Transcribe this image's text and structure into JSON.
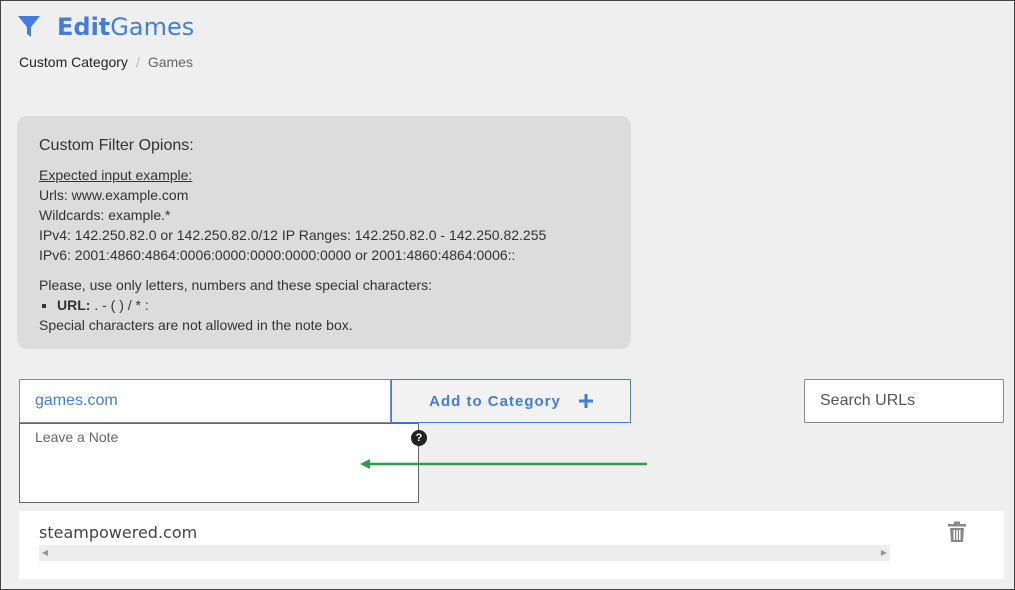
{
  "header": {
    "title_bold": "Edit",
    "title_rest": "Games",
    "icon": "filter-icon"
  },
  "breadcrumb": {
    "items": [
      "Custom Category",
      "Games"
    ],
    "separator": "/"
  },
  "info": {
    "heading": "Custom Filter Opions:",
    "example_label": "Expected input example:",
    "lines": [
      "Urls: www.example.com",
      "Wildcards: example.*",
      "IPv4: 142.250.82.0 or 142.250.82.0/12 IP Ranges: 142.250.82.0 - 142.250.82.255",
      "IPv6: 2001:4860:4864:0006:0000:0000:0000:0000 or 2001:4860:4864:0006::"
    ],
    "allowed_intro": "Please, use only letters, numbers and these special characters:",
    "url_label": "URL:",
    "url_chars": " . - ( ) / * :",
    "note_rule": "Special characters are not allowed in the note box."
  },
  "form": {
    "url_value": "games.com",
    "add_button_label": "Add to Category",
    "add_icon": "plus-icon",
    "note_placeholder": "Leave a Note",
    "help_icon": "question-icon",
    "help_glyph": "?"
  },
  "search": {
    "placeholder": "Search URLs"
  },
  "urls": {
    "items": [
      {
        "label": "steampowered.com",
        "action_icon": "trash-icon"
      }
    ]
  },
  "colors": {
    "accent": "#3f7de0",
    "annotation_arrow": "#2e9b4f"
  }
}
